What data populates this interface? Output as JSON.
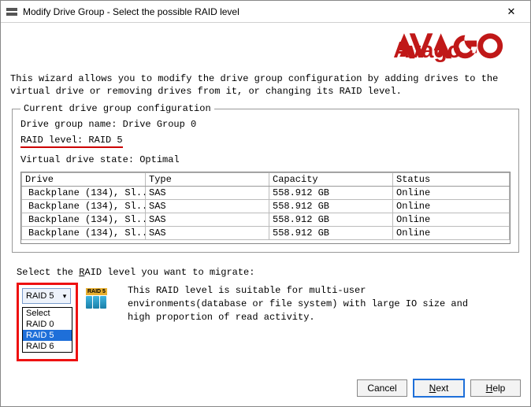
{
  "window": {
    "title": "Modify Drive Group - Select the possible RAID level"
  },
  "intro": "This wizard allows you to modify the drive group configuration by adding drives to the virtual drive or removing drives from it, or changing its RAID level.",
  "fieldset": {
    "legend": "Current drive group configuration",
    "group_name_label": "Drive group name:",
    "group_name_value": "Drive Group 0",
    "raid_label": "RAID level:",
    "raid_value": "RAID 5",
    "vd_state_label": "Virtual drive state:",
    "vd_state_value": "Optimal"
  },
  "table": {
    "headers": {
      "drive": "Drive",
      "type": "Type",
      "capacity": "Capacity",
      "status": "Status"
    },
    "rows": [
      {
        "drive": "Backplane (134), Sl...",
        "type": "SAS",
        "capacity": "558.912 GB",
        "status": "Online"
      },
      {
        "drive": "Backplane (134), Sl...",
        "type": "SAS",
        "capacity": "558.912 GB",
        "status": "Online"
      },
      {
        "drive": "Backplane (134), Sl...",
        "type": "SAS",
        "capacity": "558.912 GB",
        "status": "Online"
      },
      {
        "drive": "Backplane (134), Sl...",
        "type": "SAS",
        "capacity": "558.912 GB",
        "status": "Online"
      }
    ]
  },
  "migrate": {
    "label_pre": "Select the ",
    "label_ul": "R",
    "label_post": "AID level you want to migrate:",
    "combo_value": "RAID 5",
    "options": [
      "Select",
      "RAID 0",
      "RAID 5",
      "RAID 6"
    ],
    "selected_index": 2,
    "badge": "RAID 5",
    "description": "This RAID level is suitable for multi-user environments(database or file system) with large IO size and high proportion of read activity."
  },
  "buttons": {
    "cancel": "Cancel",
    "next_ul": "N",
    "next_rest": "ext",
    "help_ul": "H",
    "help_rest": "elp"
  }
}
